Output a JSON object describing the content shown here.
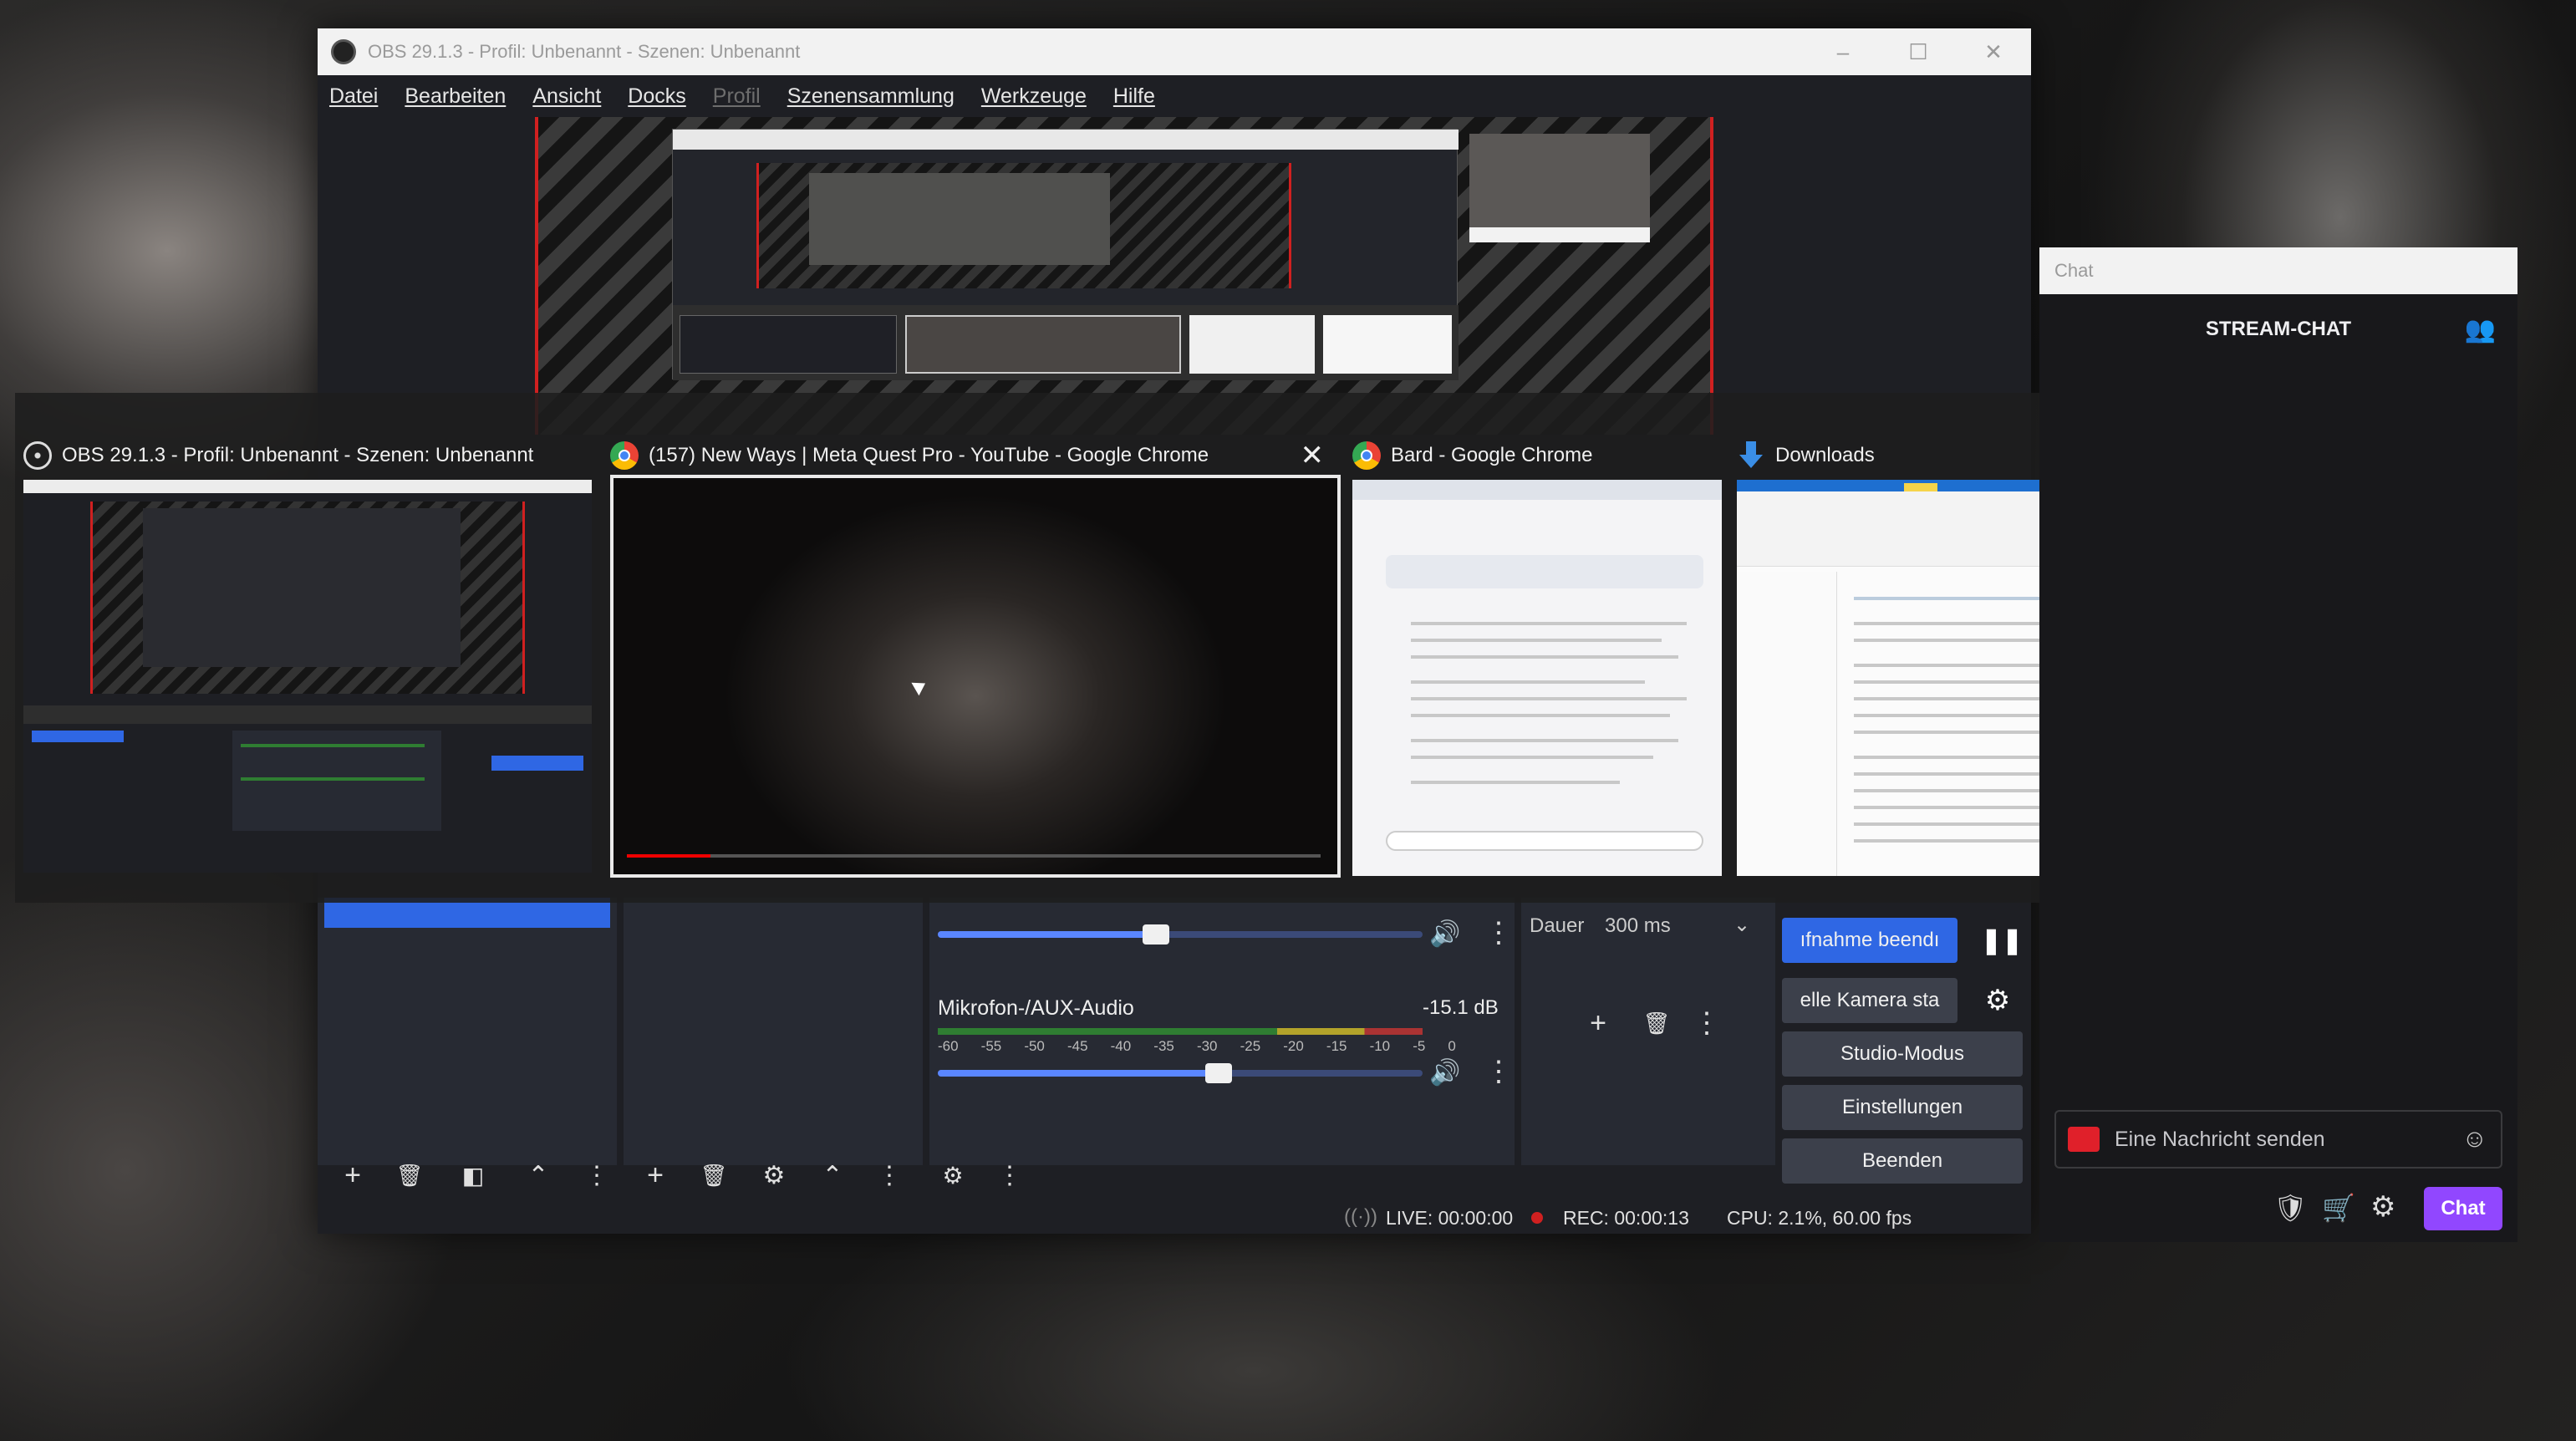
{
  "obs": {
    "title": "OBS 29.1.3 - Profil: Unbenannt - Szenen: Unbenannt",
    "menu": [
      "Datei",
      "Bearbeiten",
      "Ansicht",
      "Docks",
      "Profil",
      "Szenensammlung",
      "Werkzeuge",
      "Hilfe"
    ],
    "audio": {
      "mic_label": "Mikrofon-/AUX-Audio",
      "mic_level": "-15.1 dB",
      "ticks": [
        "-60",
        "-55",
        "-50",
        "-45",
        "-40",
        "-35",
        "-30",
        "-25",
        "-20",
        "-15",
        "-10",
        "-5",
        "0"
      ],
      "desktop_fader": 0.45,
      "mic_fader": 0.58
    },
    "transition": {
      "duration_label": "Dauer",
      "duration_value": "300 ms"
    },
    "controls": {
      "stop_recording": "ıfnahme beendı",
      "virtual_camera": "elle Kamera sta",
      "studio_mode": "Studio-Modus",
      "settings": "Einstellungen",
      "exit": "Beenden"
    },
    "status": {
      "live": "LIVE: 00:00:00",
      "rec": "REC: 00:00:13",
      "cpu": "CPU: 2.1%, 60.00 fps"
    }
  },
  "switcher": {
    "windows": [
      {
        "title": "OBS 29.1.3 - Profil: Unbenannt - Szenen: Unbenannt",
        "icon": "obs-icon"
      },
      {
        "title": "(157) New Ways | Meta Quest Pro - YouTube - Google Chrome",
        "icon": "chrome-icon"
      },
      {
        "title": "Bard - Google Chrome",
        "icon": "chrome-icon"
      },
      {
        "title": "Downloads",
        "icon": "download-icon"
      }
    ]
  },
  "chat": {
    "search_placeholder": "Chat",
    "header": "STREAM-CHAT",
    "input_placeholder": "Eine Nachricht senden",
    "send_label": "Chat"
  },
  "colors": {
    "accent_red": "#d02020",
    "obs_blue": "#2f67e4",
    "twitch_purple": "#9147ff"
  }
}
